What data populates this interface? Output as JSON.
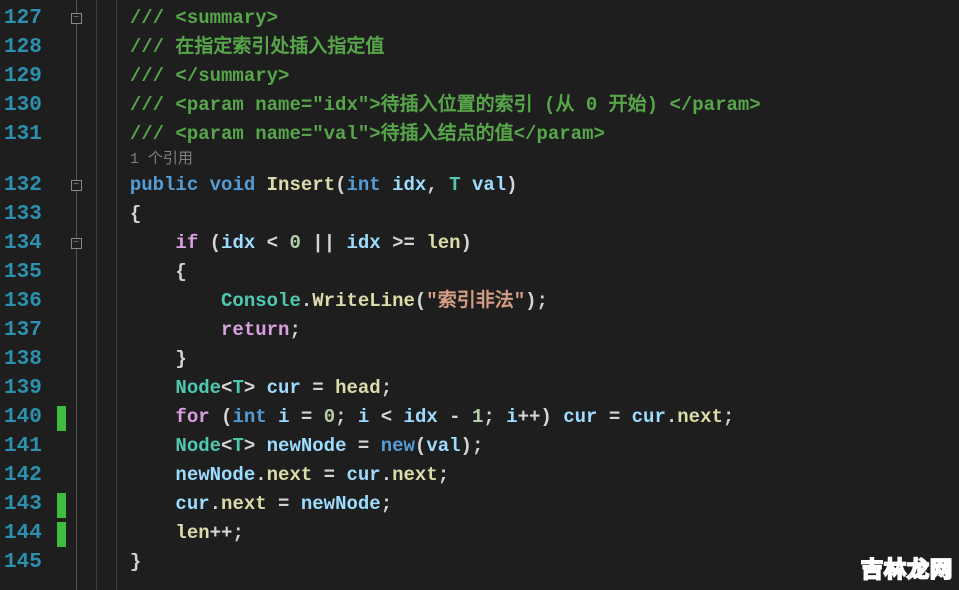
{
  "lineStart": 127,
  "lineEnd": 145,
  "codelens": "1 个引用",
  "foldBoxes": [
    127,
    132,
    134
  ],
  "changeMarks": [
    140,
    143,
    144
  ],
  "watermark": {
    "chars": [
      "吉",
      "林",
      "龙",
      "网"
    ],
    "colors": [
      "#d94b2b",
      "#d94b2b",
      "#d94b2b",
      "#2b7fd9"
    ]
  },
  "lines": {
    "127": [
      {
        "cls": "c-comment",
        "t": "/// <summary>"
      }
    ],
    "128": [
      {
        "cls": "c-comment",
        "t": "/// 在指定索引处插入指定值"
      }
    ],
    "129": [
      {
        "cls": "c-comment",
        "t": "/// </summary>"
      }
    ],
    "130": [
      {
        "cls": "c-comment",
        "t": "/// <param name=\"idx\">待插入位置的索引 (从 0 开始) </param>"
      }
    ],
    "131": [
      {
        "cls": "c-comment",
        "t": "/// <param name=\"val\">待插入结点的值</param>"
      }
    ],
    "132": [
      {
        "cls": "c-keyword",
        "t": "public"
      },
      {
        "cls": "c-punct",
        "t": " "
      },
      {
        "cls": "c-keyword",
        "t": "void"
      },
      {
        "cls": "c-punct",
        "t": " "
      },
      {
        "cls": "c-method",
        "t": "Insert"
      },
      {
        "cls": "c-punct",
        "t": "("
      },
      {
        "cls": "c-keyword",
        "t": "int"
      },
      {
        "cls": "c-punct",
        "t": " "
      },
      {
        "cls": "c-var",
        "t": "idx"
      },
      {
        "cls": "c-punct",
        "t": ", "
      },
      {
        "cls": "c-type",
        "t": "T"
      },
      {
        "cls": "c-punct",
        "t": " "
      },
      {
        "cls": "c-var",
        "t": "val"
      },
      {
        "cls": "c-punct",
        "t": ")"
      }
    ],
    "133": [
      {
        "cls": "c-punct",
        "t": "{"
      }
    ],
    "134": [
      {
        "cls": "c-punct",
        "t": "    "
      },
      {
        "cls": "c-flow",
        "t": "if"
      },
      {
        "cls": "c-punct",
        "t": " ("
      },
      {
        "cls": "c-var",
        "t": "idx"
      },
      {
        "cls": "c-punct",
        "t": " < "
      },
      {
        "cls": "c-num",
        "t": "0"
      },
      {
        "cls": "c-punct",
        "t": " || "
      },
      {
        "cls": "c-var",
        "t": "idx"
      },
      {
        "cls": "c-punct",
        "t": " >= "
      },
      {
        "cls": "c-field",
        "t": "len"
      },
      {
        "cls": "c-punct",
        "t": ")"
      }
    ],
    "135": [
      {
        "cls": "c-punct",
        "t": "    {"
      }
    ],
    "136": [
      {
        "cls": "c-punct",
        "t": "        "
      },
      {
        "cls": "c-type",
        "t": "Console"
      },
      {
        "cls": "c-punct",
        "t": "."
      },
      {
        "cls": "c-method",
        "t": "WriteLine"
      },
      {
        "cls": "c-punct",
        "t": "("
      },
      {
        "cls": "c-string",
        "t": "\"索引非法\""
      },
      {
        "cls": "c-punct",
        "t": ");"
      }
    ],
    "137": [
      {
        "cls": "c-punct",
        "t": "        "
      },
      {
        "cls": "c-flow",
        "t": "return"
      },
      {
        "cls": "c-punct",
        "t": ";"
      }
    ],
    "138": [
      {
        "cls": "c-punct",
        "t": "    }"
      }
    ],
    "139": [
      {
        "cls": "c-punct",
        "t": "    "
      },
      {
        "cls": "c-type",
        "t": "Node"
      },
      {
        "cls": "c-generic",
        "t": "<"
      },
      {
        "cls": "c-type",
        "t": "T"
      },
      {
        "cls": "c-generic",
        "t": ">"
      },
      {
        "cls": "c-punct",
        "t": " "
      },
      {
        "cls": "c-var",
        "t": "cur"
      },
      {
        "cls": "c-punct",
        "t": " = "
      },
      {
        "cls": "c-field",
        "t": "head"
      },
      {
        "cls": "c-punct",
        "t": ";"
      }
    ],
    "140": [
      {
        "cls": "c-punct",
        "t": "    "
      },
      {
        "cls": "c-flow",
        "t": "for"
      },
      {
        "cls": "c-punct",
        "t": " ("
      },
      {
        "cls": "c-keyword",
        "t": "int"
      },
      {
        "cls": "c-punct",
        "t": " "
      },
      {
        "cls": "c-var",
        "t": "i"
      },
      {
        "cls": "c-punct",
        "t": " = "
      },
      {
        "cls": "c-num",
        "t": "0"
      },
      {
        "cls": "c-punct",
        "t": "; "
      },
      {
        "cls": "c-var",
        "t": "i"
      },
      {
        "cls": "c-punct",
        "t": " < "
      },
      {
        "cls": "c-var",
        "t": "idx"
      },
      {
        "cls": "c-punct",
        "t": " - "
      },
      {
        "cls": "c-num",
        "t": "1"
      },
      {
        "cls": "c-punct",
        "t": "; "
      },
      {
        "cls": "c-var",
        "t": "i"
      },
      {
        "cls": "c-punct",
        "t": "++) "
      },
      {
        "cls": "c-var",
        "t": "cur"
      },
      {
        "cls": "c-punct",
        "t": " = "
      },
      {
        "cls": "c-var",
        "t": "cur"
      },
      {
        "cls": "c-punct",
        "t": "."
      },
      {
        "cls": "c-field",
        "t": "next"
      },
      {
        "cls": "c-punct",
        "t": ";"
      }
    ],
    "141": [
      {
        "cls": "c-punct",
        "t": "    "
      },
      {
        "cls": "c-type",
        "t": "Node"
      },
      {
        "cls": "c-generic",
        "t": "<"
      },
      {
        "cls": "c-type",
        "t": "T"
      },
      {
        "cls": "c-generic",
        "t": ">"
      },
      {
        "cls": "c-punct",
        "t": " "
      },
      {
        "cls": "c-var",
        "t": "newNode"
      },
      {
        "cls": "c-punct",
        "t": " = "
      },
      {
        "cls": "c-keyword",
        "t": "new"
      },
      {
        "cls": "c-punct",
        "t": "("
      },
      {
        "cls": "c-var",
        "t": "val"
      },
      {
        "cls": "c-punct",
        "t": ");"
      }
    ],
    "142": [
      {
        "cls": "c-punct",
        "t": "    "
      },
      {
        "cls": "c-var",
        "t": "newNode"
      },
      {
        "cls": "c-punct",
        "t": "."
      },
      {
        "cls": "c-field",
        "t": "next"
      },
      {
        "cls": "c-punct",
        "t": " = "
      },
      {
        "cls": "c-var",
        "t": "cur"
      },
      {
        "cls": "c-punct",
        "t": "."
      },
      {
        "cls": "c-field",
        "t": "next"
      },
      {
        "cls": "c-punct",
        "t": ";"
      }
    ],
    "143": [
      {
        "cls": "c-punct",
        "t": "    "
      },
      {
        "cls": "c-var",
        "t": "cur"
      },
      {
        "cls": "c-punct",
        "t": "."
      },
      {
        "cls": "c-field",
        "t": "next"
      },
      {
        "cls": "c-punct",
        "t": " = "
      },
      {
        "cls": "c-var",
        "t": "newNode"
      },
      {
        "cls": "c-punct",
        "t": ";"
      }
    ],
    "144": [
      {
        "cls": "c-punct",
        "t": "    "
      },
      {
        "cls": "c-field",
        "t": "len"
      },
      {
        "cls": "c-punct",
        "t": "++;"
      }
    ],
    "145": [
      {
        "cls": "c-punct",
        "t": "}"
      }
    ]
  }
}
